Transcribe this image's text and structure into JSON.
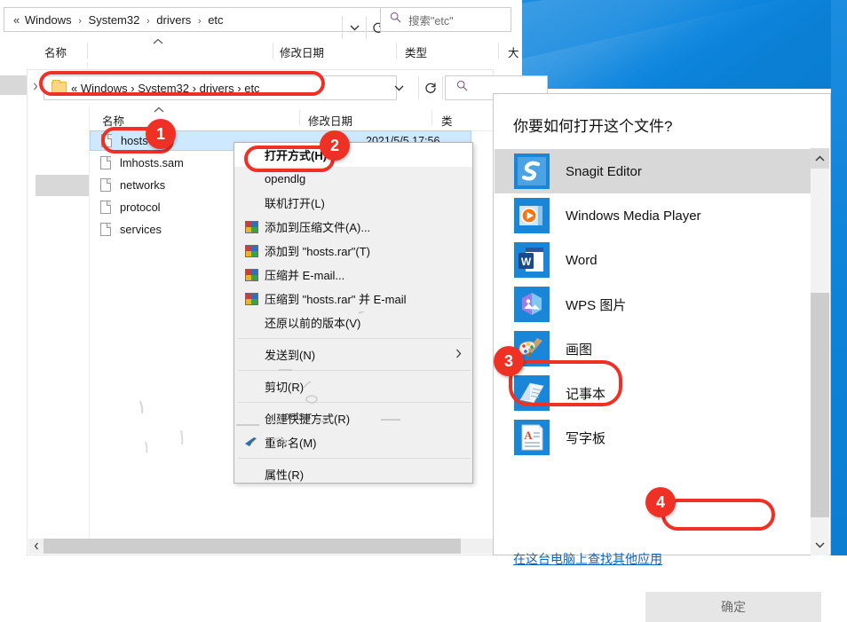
{
  "explorer_outer": {
    "breadcrumb": {
      "prefix": "«",
      "parts": [
        "Windows",
        "System32",
        "drivers",
        "etc"
      ],
      "separator": "›"
    },
    "dropdown_icon": "chevron-down-icon",
    "refresh_icon": "refresh-icon",
    "search": {
      "icon": "search-icon",
      "placeholder": "搜索\"etc\""
    },
    "columns": [
      {
        "label": "名称"
      },
      {
        "label": "修改日期"
      },
      {
        "label": "类型"
      },
      {
        "label": "大"
      }
    ],
    "sort_indicator": "caret-up-icon"
  },
  "explorer_inner": {
    "breadcrumb": {
      "prefix": "«",
      "parts": [
        "Windows",
        "System32",
        "drivers",
        "etc"
      ],
      "separator": "›"
    },
    "folder_icon": "folder-icon",
    "dropdown_icon": "chevron-down-icon",
    "refresh_icon": "refresh-icon",
    "search_icon": "search-icon",
    "columns": [
      {
        "label": "名称"
      },
      {
        "label": "修改日期"
      },
      {
        "label": "类"
      }
    ],
    "files": [
      {
        "name": "hosts",
        "date": "2021/5/5 17:56",
        "selected": true
      },
      {
        "name": "lmhosts.sam",
        "date": "",
        "selected": false
      },
      {
        "name": "networks",
        "date": "",
        "selected": false
      },
      {
        "name": "protocol",
        "date": "",
        "selected": false
      },
      {
        "name": "services",
        "date": "",
        "selected": false
      }
    ],
    "hscroll": {
      "left_arrow": "chevron-left-icon"
    }
  },
  "context_menu": {
    "items": [
      {
        "label": "打开方式(H)",
        "icon": null,
        "bold": true,
        "highlight": true
      },
      {
        "label": "opendlg",
        "icon": null
      },
      {
        "label": "联机打开(L)",
        "icon": null
      },
      {
        "label": "添加到压缩文件(A)...",
        "icon": "winrar-icon"
      },
      {
        "label": "添加到 \"hosts.rar\"(T)",
        "icon": "winrar-icon"
      },
      {
        "label": "压缩并 E-mail...",
        "icon": "winrar-icon"
      },
      {
        "label": "压缩到 \"hosts.rar\" 并 E-mail",
        "icon": "winrar-icon"
      },
      {
        "label": "还原以前的版本(V)",
        "icon": null
      },
      {
        "separator": true
      },
      {
        "label": "发送到(N)",
        "icon": null,
        "submenu": true
      },
      {
        "separator": true
      },
      {
        "label": "剪切(R)",
        "icon": null
      },
      {
        "separator": true
      },
      {
        "label": "创建快捷方式(R)",
        "icon": null
      },
      {
        "label": "重命名(M)",
        "icon": "rename-icon"
      },
      {
        "separator": true
      },
      {
        "label": "属性(R)",
        "icon": null
      }
    ],
    "ghost_text": "ɔsts.r"
  },
  "open_with": {
    "title": "你要如何打开这个文件?",
    "apps": [
      {
        "name": "Snagit Editor",
        "icon": "snagit-icon",
        "selected": true
      },
      {
        "name": "Windows Media Player",
        "icon": "media-player-icon",
        "selected": false
      },
      {
        "name": "Word",
        "icon": "word-icon",
        "selected": false
      },
      {
        "name": "WPS 图片",
        "icon": "wps-picture-icon",
        "selected": false
      },
      {
        "name": "画图",
        "icon": "paint-icon",
        "selected": false
      },
      {
        "name": "记事本",
        "icon": "notepad-icon",
        "selected": false
      },
      {
        "name": "写字板",
        "icon": "wordpad-icon",
        "selected": false
      }
    ],
    "more_apps_link": "在这台电脑上查找其他应用",
    "ok_button": "确定",
    "scroll_up_icon": "chevron-up-icon",
    "scroll_down_icon": "chevron-down-icon"
  },
  "annotations": {
    "badges": [
      {
        "number": "1",
        "target": "hosts-file-row"
      },
      {
        "number": "2",
        "target": "open-with-menu-item"
      },
      {
        "number": "3",
        "target": "notepad-app-row"
      },
      {
        "number": "4",
        "target": "ok-button"
      }
    ],
    "highlight_color": "#ee3124"
  }
}
